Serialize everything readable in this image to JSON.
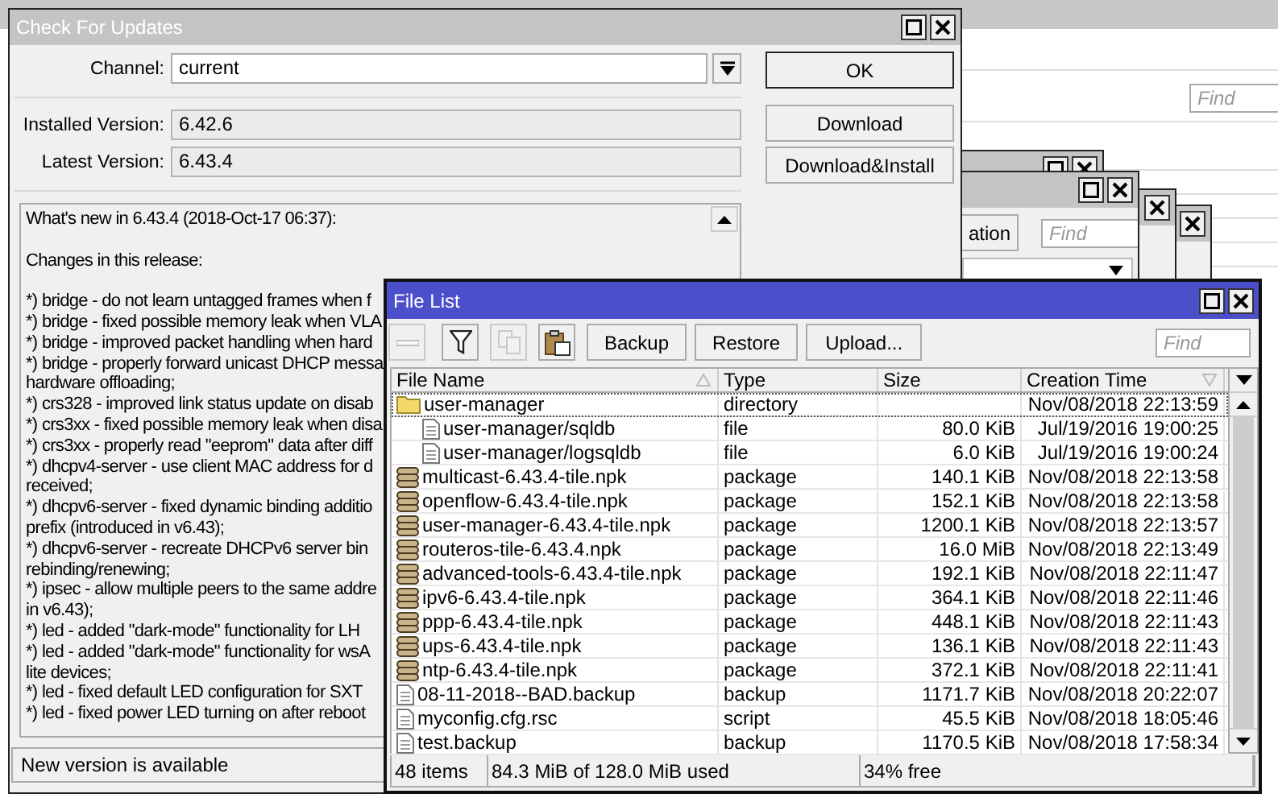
{
  "background_app": {
    "find_placeholder": "Find"
  },
  "stacked_windows": [
    {
      "kind": "close"
    },
    {
      "kind": "close"
    },
    {
      "kind": "both"
    },
    {
      "kind": "tools",
      "button": "ation",
      "find_placeholder": "Find"
    }
  ],
  "update_window": {
    "title": "Check For Updates",
    "channel_label": "Channel:",
    "channel": "current",
    "installed_label": "Installed Version:",
    "installed": "6.42.6",
    "latest_label": "Latest Version:",
    "latest": "6.43.4",
    "buttons": [
      {
        "label": "OK",
        "default": true
      },
      {
        "label": "Download",
        "default": false
      },
      {
        "label": "Download&Install",
        "default": false
      }
    ],
    "changelog": [
      {
        "lines": [
          "What's new in 6.43.4 (2018-Oct-17 06:37):"
        ]
      },
      {
        "lines": [
          "Changes in this release:"
        ]
      },
      {
        "lines": [
          "*) bridge - do not learn untagged frames when f",
          "*) bridge - fixed possible memory leak when VLA",
          "*) bridge - improved packet handling when hard",
          "*) bridge - properly forward unicast DHCP messa",
          "hardware offloading;",
          "*) crs328 - improved link status update on disab",
          "*) crs3xx - fixed possible memory leak when disa",
          "*) crs3xx - properly read \"eeprom\" data after diff",
          "*) dhcpv4-server - use client MAC address for d",
          "received;",
          "*) dhcpv6-server - fixed dynamic binding additio",
          "prefix (introduced in v6.43);",
          "*) dhcpv6-server - recreate DHCPv6 server bin",
          "rebinding/renewing;",
          "*) ipsec - allow multiple peers to the same addre",
          "in v6.43);",
          "*) led - added \"dark-mode\" functionality for LH",
          "*) led - added \"dark-mode\" functionality for wsA",
          "lite devices;",
          "*) led - fixed default LED configuration for SXT",
          "*) led - fixed power LED turning on after reboot"
        ]
      }
    ],
    "status": "New version is available"
  },
  "file_list": {
    "title": "File List",
    "toolbar": [
      {
        "kind": "remove",
        "disabled": true
      },
      {
        "kind": "filter",
        "disabled": false
      },
      {
        "kind": "copy",
        "disabled": true
      },
      {
        "kind": "paste",
        "disabled": false
      }
    ],
    "buttons": [
      "Backup",
      "Restore",
      "Upload..."
    ],
    "find_placeholder": "Find",
    "columns": [
      {
        "label": "File Name",
        "sort_ascending": true,
        "sort_descending": false
      },
      {
        "label": "Type",
        "sort_ascending": false,
        "sort_descending": false
      },
      {
        "label": "Size",
        "sort_ascending": false,
        "sort_descending": false
      },
      {
        "label": "Creation Time",
        "sort_ascending": false,
        "sort_descending": true
      }
    ],
    "rows": [
      {
        "kind": "folder",
        "name": "user-manager",
        "type": "directory",
        "time": "Nov/08/2018 22:13:59",
        "selected": true,
        "children": [
          {
            "kind": "doc",
            "name": "user-manager/sqldb",
            "type": "file",
            "size": "80.0 KiB",
            "time": "Jul/19/2016 19:00:25",
            "selected": false
          },
          {
            "kind": "doc",
            "name": "user-manager/logsqldb",
            "type": "file",
            "size": "6.0 KiB",
            "time": "Jul/19/2016 19:00:24",
            "selected": false
          }
        ]
      },
      {
        "kind": "pkg",
        "name": "multicast-6.43.4-tile.npk",
        "type": "package",
        "size": "140.1 KiB",
        "time": "Nov/08/2018 22:13:58",
        "selected": false
      },
      {
        "kind": "pkg",
        "name": "openflow-6.43.4-tile.npk",
        "type": "package",
        "size": "152.1 KiB",
        "time": "Nov/08/2018 22:13:58",
        "selected": false
      },
      {
        "kind": "pkg",
        "name": "user-manager-6.43.4-tile.npk",
        "type": "package",
        "size": "1200.1 KiB",
        "time": "Nov/08/2018 22:13:57",
        "selected": false
      },
      {
        "kind": "pkg",
        "name": "routeros-tile-6.43.4.npk",
        "type": "package",
        "size": "16.0 MiB",
        "time": "Nov/08/2018 22:13:49",
        "selected": false
      },
      {
        "kind": "pkg",
        "name": "advanced-tools-6.43.4-tile.npk",
        "type": "package",
        "size": "192.1 KiB",
        "time": "Nov/08/2018 22:11:47",
        "selected": false
      },
      {
        "kind": "pkg",
        "name": "ipv6-6.43.4-tile.npk",
        "type": "package",
        "size": "364.1 KiB",
        "time": "Nov/08/2018 22:11:46",
        "selected": false
      },
      {
        "kind": "pkg",
        "name": "ppp-6.43.4-tile.npk",
        "type": "package",
        "size": "448.1 KiB",
        "time": "Nov/08/2018 22:11:43",
        "selected": false
      },
      {
        "kind": "pkg",
        "name": "ups-6.43.4-tile.npk",
        "type": "package",
        "size": "136.1 KiB",
        "time": "Nov/08/2018 22:11:43",
        "selected": false
      },
      {
        "kind": "pkg",
        "name": "ntp-6.43.4-tile.npk",
        "type": "package",
        "size": "372.1 KiB",
        "time": "Nov/08/2018 22:11:41",
        "selected": false
      },
      {
        "kind": "doc",
        "name": "08-11-2018--BAD.backup",
        "type": "backup",
        "size": "1171.7 KiB",
        "time": "Nov/08/2018 20:22:07",
        "selected": false
      },
      {
        "kind": "doc",
        "name": "myconfig.cfg.rsc",
        "type": "script",
        "size": "45.5 KiB",
        "time": "Nov/08/2018 18:05:46",
        "selected": false
      },
      {
        "kind": "doc",
        "name": "test.backup",
        "type": "backup",
        "size": "1170.5 KiB",
        "time": "Nov/08/2018 17:58:34",
        "selected": false
      }
    ],
    "status_bar": [
      "48 items",
      "84.3 MiB of 128.0 MiB used",
      "34% free"
    ]
  }
}
